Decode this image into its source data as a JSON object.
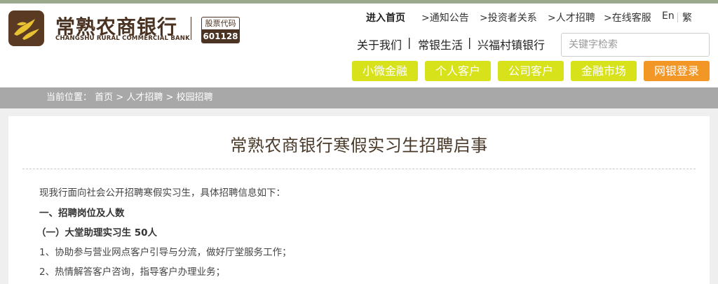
{
  "brand": {
    "name_cn": "常熟农商银行",
    "name_en": "CHANGSHU RURAL COMMERCIAL BANK",
    "stock_label": "股票代码",
    "stock_code": "601128"
  },
  "top_links": [
    "进入首页",
    ">通知公告",
    ">投资者关系",
    ">人才招聘",
    ">在线客服"
  ],
  "lang": {
    "en": "En",
    "trad": "繁"
  },
  "sub_links": [
    "关于我们",
    "|",
    "常银生活",
    "|",
    "兴福村镇银行"
  ],
  "search": {
    "placeholder": "关键字检索"
  },
  "nav_buttons": [
    "小微金融",
    "个人客户",
    "公司客户",
    "金融市场",
    "网银登录"
  ],
  "breadcrumb": {
    "prefix": "当前位置：",
    "items": [
      "首页",
      ">",
      "人才招聘",
      ">",
      "校园招聘"
    ]
  },
  "article": {
    "title": "常熟农商银行寒假实习生招聘启事",
    "paragraphs": [
      "现我行面向社会公开招聘寒假实习生，具体招聘信息如下：",
      "一、招聘岗位及人数",
      "（一）大堂助理实习生  50人",
      "1、协助参与营业网点客户引导与分流，做好厅堂服务工作；",
      "2、热情解答客户咨询，指导客户办理业务；"
    ]
  },
  "colors": {
    "accent_yellow": "#d7e21b",
    "accent_orange": "#f29626",
    "brand_brown": "#4a3322",
    "crumb_gray": "#a8a8a8"
  }
}
